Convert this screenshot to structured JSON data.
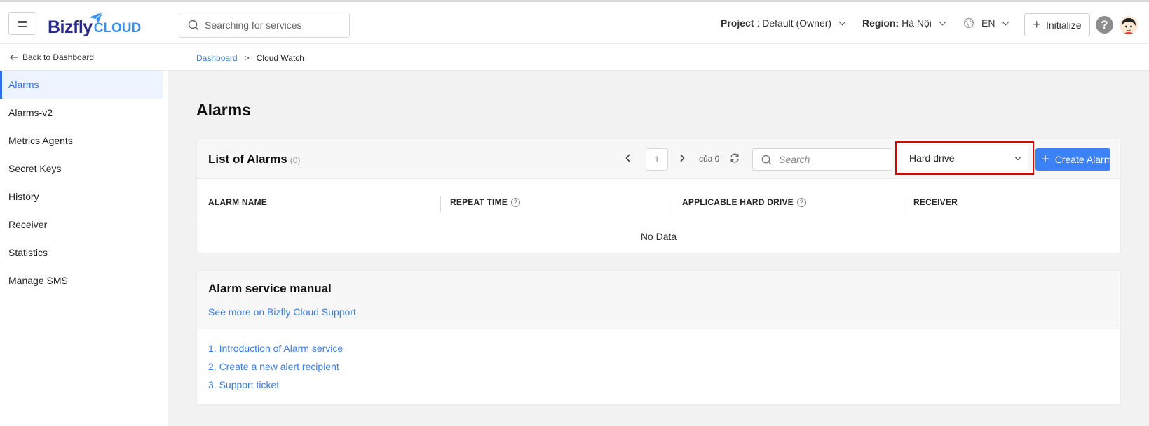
{
  "header": {
    "logo_main": "Bizfly",
    "logo_sub": "CLOUD",
    "search_placeholder": "Searching for services",
    "project_label": "Project",
    "project_value": ": Default (Owner)",
    "region_label": "Region:",
    "region_value": "Hà Nội",
    "language": "EN",
    "initialize_label": "Initialize",
    "help_label": "?"
  },
  "subheader": {
    "back_label": "Back to Dashboard",
    "breadcrumb": [
      "Dashboard",
      "Cloud Watch"
    ],
    "breadcrumb_sep": ">"
  },
  "sidebar": {
    "items": [
      {
        "label": "Alarms",
        "active": true
      },
      {
        "label": "Alarms-v2"
      },
      {
        "label": "Metrics Agents"
      },
      {
        "label": "Secret Keys"
      },
      {
        "label": "History"
      },
      {
        "label": "Receiver"
      },
      {
        "label": "Statistics"
      },
      {
        "label": "Manage SMS"
      }
    ]
  },
  "main": {
    "page_title": "Alarms",
    "alarms_card": {
      "title": "List of Alarms",
      "count": "(0)",
      "page": "1",
      "of_text": "của 0",
      "search_placeholder": "Search",
      "filter_value": "Hard drive",
      "create_label": "Create Alarm",
      "columns": [
        "ALARM NAME",
        "REPEAT TIME",
        "APPLICABLE HARD DRIVE",
        "RECEIVER"
      ],
      "empty_text": "No Data"
    },
    "manual_card": {
      "title": "Alarm service manual",
      "support_link": "See more on Bizfly Cloud Support",
      "items": [
        "1. Introduction of Alarm service",
        "2. Create a new alert recipient",
        "3. Support ticket"
      ]
    }
  },
  "colors": {
    "accent": "#3b82f6",
    "link": "#3a7ce8",
    "highlight": "#e00000",
    "logo_dark": "#2b2b8a"
  }
}
